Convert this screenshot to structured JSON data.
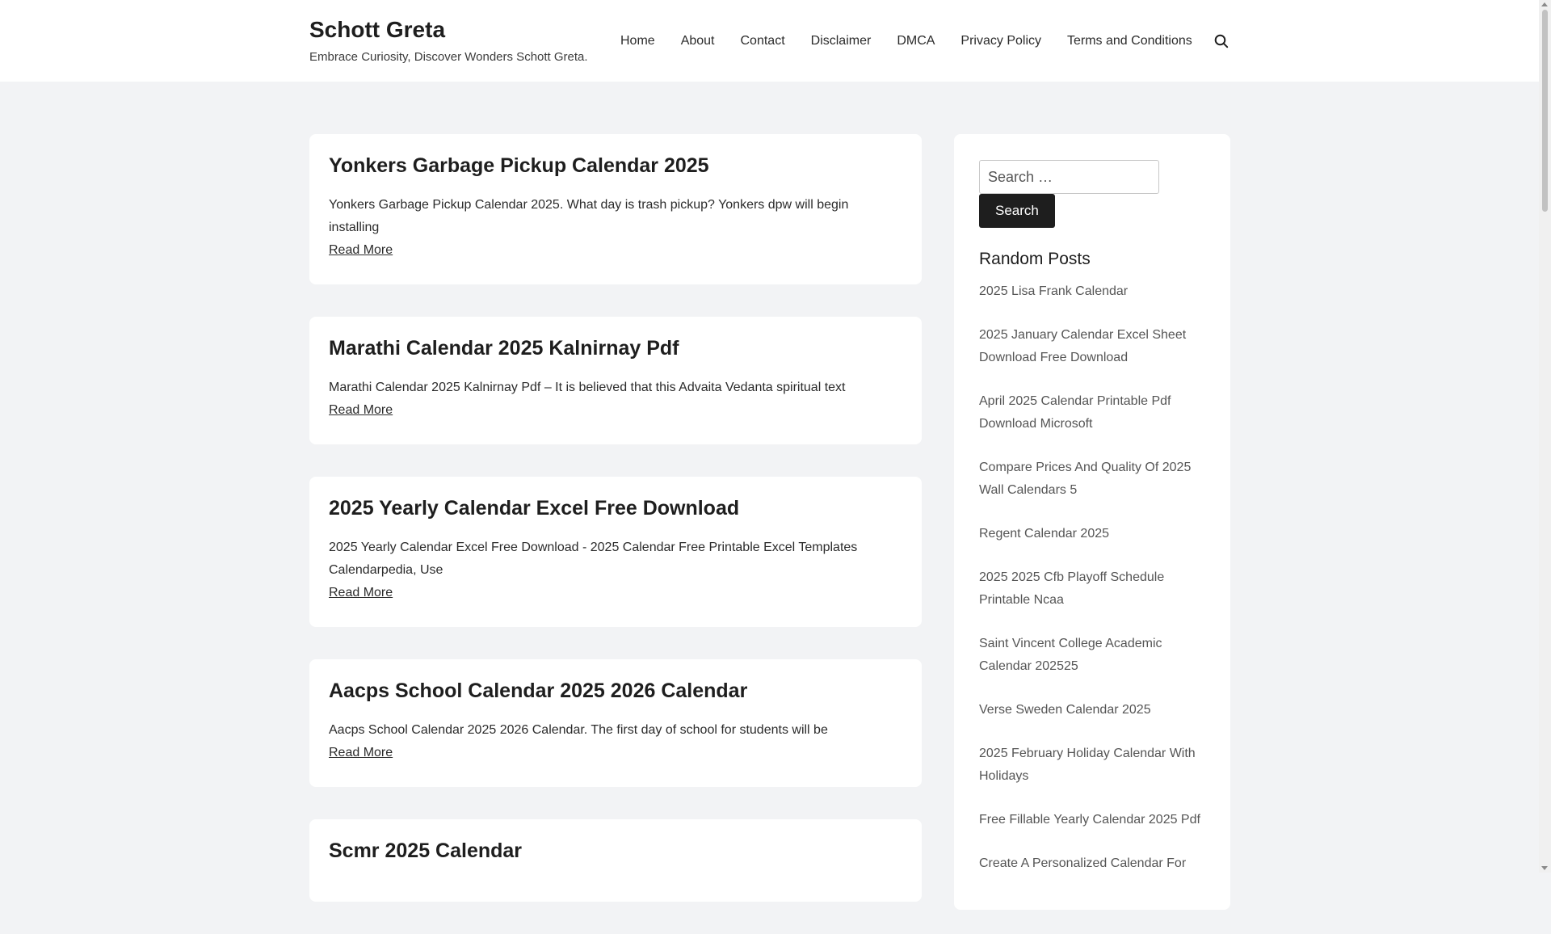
{
  "header": {
    "site_title": "Schott Greta",
    "tagline": "Embrace Curiosity, Discover Wonders Schott Greta.",
    "nav": [
      {
        "label": "Home"
      },
      {
        "label": "About"
      },
      {
        "label": "Contact"
      },
      {
        "label": "Disclaimer"
      },
      {
        "label": "DMCA"
      },
      {
        "label": "Privacy Policy"
      },
      {
        "label": "Terms and Conditions"
      }
    ],
    "search_icon": "search-icon"
  },
  "posts": [
    {
      "title": "Yonkers Garbage Pickup Calendar 2025",
      "excerpt": "Yonkers Garbage Pickup Calendar 2025. What day is trash pickup? Yonkers dpw will begin installing",
      "read_more": "Read More"
    },
    {
      "title": "Marathi Calendar 2025 Kalnirnay Pdf",
      "excerpt": "Marathi Calendar 2025 Kalnirnay Pdf – It is believed that this Advaita Vedanta spiritual text",
      "read_more": "Read More"
    },
    {
      "title": "2025 Yearly Calendar Excel Free Download",
      "excerpt": "2025 Yearly Calendar Excel Free Download - 2025 Calendar Free Printable Excel Templates Calendarpedia, Use",
      "read_more": "Read More"
    },
    {
      "title": "Aacps School Calendar 2025 2026 Calendar",
      "excerpt": "Aacps School Calendar 2025 2026 Calendar. The first day of school for students will be",
      "read_more": "Read More"
    },
    {
      "title": "Scmr 2025 Calendar",
      "excerpt": "",
      "read_more": ""
    }
  ],
  "sidebar": {
    "search_placeholder": "Search …",
    "search_button": "Search",
    "random_posts_title": "Random Posts",
    "random_posts": [
      "2025 Lisa Frank Calendar",
      "2025 January Calendar Excel Sheet Download Free Download",
      "April 2025 Calendar Printable Pdf Download Microsoft",
      "Compare Prices And Quality Of 2025 Wall Calendars 5",
      "Regent Calendar 2025",
      "2025 2025 Cfb Playoff Schedule Printable Ncaa",
      "Saint Vincent College Academic Calendar 202525",
      "Verse Sweden Calendar 2025",
      "2025 February Holiday Calendar With Holidays",
      "Free Fillable Yearly Calendar 2025 Pdf",
      "Create A Personalized Calendar For"
    ]
  },
  "colors": {
    "page_bg": "#f2f3f5",
    "card_bg": "#ffffff",
    "text": "#1e1e1e",
    "muted": "#555555",
    "button_bg": "#1e1e1e"
  }
}
